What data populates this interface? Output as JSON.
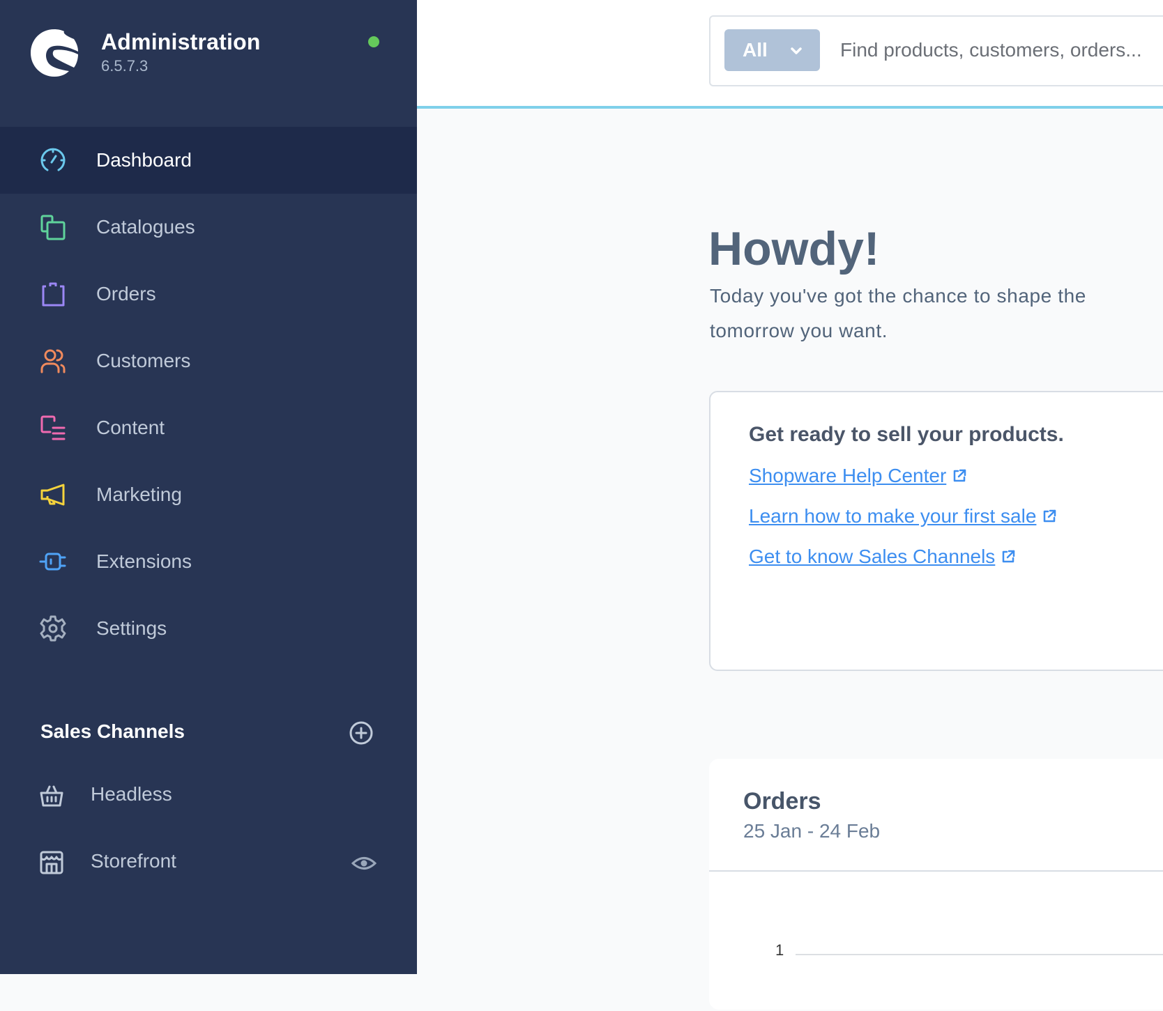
{
  "brand": {
    "title": "Administration",
    "version": "6.5.7.3",
    "status": "online",
    "status_color": "#65c95b"
  },
  "nav": {
    "items": [
      {
        "label": "Dashboard",
        "icon": "gauge-icon",
        "color": "#6bc8ec",
        "active": true
      },
      {
        "label": "Catalogues",
        "icon": "catalogue-icon",
        "color": "#5fd39b",
        "active": false
      },
      {
        "label": "Orders",
        "icon": "shopping-bag-icon",
        "color": "#9b87f5",
        "active": false
      },
      {
        "label": "Customers",
        "icon": "users-icon",
        "color": "#f08a5d",
        "active": false
      },
      {
        "label": "Content",
        "icon": "content-icon",
        "color": "#f06ab0",
        "active": false
      },
      {
        "label": "Marketing",
        "icon": "megaphone-icon",
        "color": "#f5d33c",
        "active": false
      },
      {
        "label": "Extensions",
        "icon": "plug-icon",
        "color": "#4fa3f7",
        "active": false
      },
      {
        "label": "Settings",
        "icon": "gear-icon",
        "color": "#a5b0c0",
        "active": false
      }
    ]
  },
  "sales_channels": {
    "title": "Sales Channels",
    "items": [
      {
        "label": "Headless",
        "icon": "basket-icon"
      },
      {
        "label": "Storefront",
        "icon": "storefront-icon",
        "action_icon": "eye-icon"
      }
    ]
  },
  "search": {
    "type_label": "All",
    "placeholder": "Find products, customers, orders..."
  },
  "greeting": {
    "title": "Howdy!",
    "subtitle": "Today you've got the chance to shape the tomorrow you want."
  },
  "getting_started": {
    "title": "Get ready to sell your products.",
    "links": [
      {
        "label": "Shopware Help Center"
      },
      {
        "label": "Learn how to make your first sale"
      },
      {
        "label": "Get to know Sales Channels"
      }
    ]
  },
  "orders_card": {
    "title": "Orders",
    "range": "25 Jan - 24 Feb",
    "y_tick": "1"
  }
}
